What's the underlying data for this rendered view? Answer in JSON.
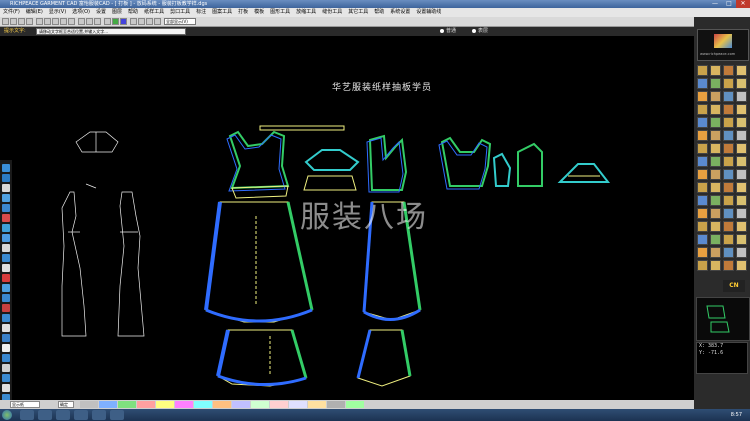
{
  "window": {
    "title": "RICHPEACE GARMENT CAD 富怡服装CAD - [ 打板 ] - 放码系统 - 服装打板教学样.dgs",
    "min_label": "—",
    "max_label": "□",
    "close_label": "✕"
  },
  "menu": [
    "文件(F)",
    "编辑(E)",
    "显示(V)",
    "选项(O)",
    "设置",
    "图层",
    "帮助",
    "纸样工具",
    "剪口工具",
    "标注",
    "图案工具",
    "打板",
    "模板",
    "图形工具",
    "放缩工具",
    "缝份工具",
    "其它工具",
    "帮助",
    "系统设置",
    "设置辅助线"
  ],
  "toolbar": {
    "layer_select": "全部显示(V)"
  },
  "prompt": {
    "label": "提示文字:",
    "text": "请移动文字框至合适位置,并输入文字...",
    "radio1": "普通",
    "radio2": "表层"
  },
  "canvas": {
    "title": "华艺服装纸样抽板学员",
    "watermark": "服装八场"
  },
  "right_panel": {
    "logo_url_text": "www.richpeace.com",
    "cn_button": "CN",
    "coord_x": "X: 383.7",
    "coord_y": "Y: -71.6"
  },
  "status": {
    "field": "显示纸",
    "field2": "确定"
  },
  "taskbar": {
    "clock": "8:57"
  },
  "colors": {
    "pattern_outline": "#f0f080",
    "pattern_green": "#33cc66",
    "pattern_blue": "#2f6cff",
    "pattern_cyan": "#33cccc",
    "canvas_bg": "#000000"
  }
}
